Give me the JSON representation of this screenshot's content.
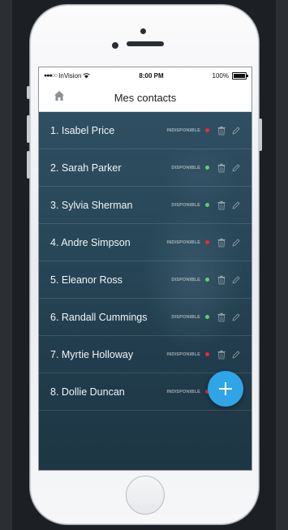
{
  "statusbar": {
    "carrier": "InVision",
    "time": "8:00 PM",
    "battery": "100%",
    "battery_level": 1.0
  },
  "navbar": {
    "title": "Mes contacts",
    "home_icon": "home-icon"
  },
  "contacts": [
    {
      "label": "1. Isabel Price",
      "status": "INDISPONIBLE",
      "dot_color": "#e8293a"
    },
    {
      "label": "2. Sarah Parker",
      "status": "DISPONIBLE",
      "dot_color": "#5fd35f"
    },
    {
      "label": "3. Sylvia Sherman",
      "status": "DISPONIBLE",
      "dot_color": "#5fd35f"
    },
    {
      "label": "4. Andre Simpson",
      "status": "INDISPONIBLE",
      "dot_color": "#e8293a"
    },
    {
      "label": "5. Eleanor Ross",
      "status": "DISPONIBLE",
      "dot_color": "#5fd35f"
    },
    {
      "label": "6. Randall Cummings",
      "status": "DISPONIBLE",
      "dot_color": "#5fd35f"
    },
    {
      "label": "7. Myrtie Holloway",
      "status": "INDISPONIBLE",
      "dot_color": "#e8293a"
    },
    {
      "label": "8. Dollie Duncan",
      "status": "INDISPONIBLE",
      "dot_color": "#e8293a"
    }
  ],
  "fab": {
    "icon": "plus-icon",
    "color": "#2fa4e7"
  },
  "colors": {
    "available": "#5fd35f",
    "unavailable": "#e8293a",
    "accent": "#2fa4e7"
  }
}
